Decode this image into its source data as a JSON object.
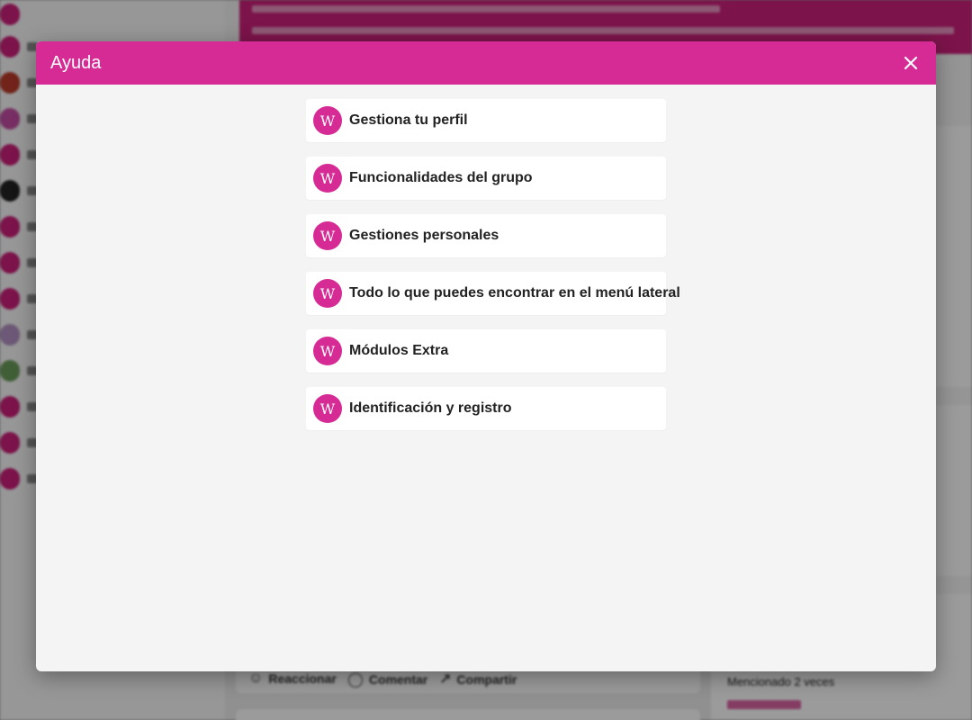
{
  "modal": {
    "title": "Ayuda",
    "close_icon": "close-icon",
    "header_color": "#d62b94",
    "items": [
      {
        "label": "Gestiona tu perfil",
        "icon": "w-logo-icon",
        "icon_glyph": "W"
      },
      {
        "label": "Funcionalidades del grupo",
        "icon": "w-logo-icon",
        "icon_glyph": "W"
      },
      {
        "label": "Gestiones personales",
        "icon": "w-logo-icon",
        "icon_glyph": "W"
      },
      {
        "label": "Todo lo que puedes encontrar en el menú lateral",
        "icon": "w-logo-icon",
        "icon_glyph": "W"
      },
      {
        "label": "Módulos Extra",
        "icon": "w-logo-icon",
        "icon_glyph": "W"
      },
      {
        "label": "Identificación y registro",
        "icon": "w-logo-icon",
        "icon_glyph": "W"
      }
    ]
  },
  "background": {
    "actions": {
      "react": "Reaccionar",
      "comment": "Comentar",
      "share": "Compartir"
    },
    "mentioned": "Mencionado 2 veces",
    "accent_color": "#c81f78"
  }
}
